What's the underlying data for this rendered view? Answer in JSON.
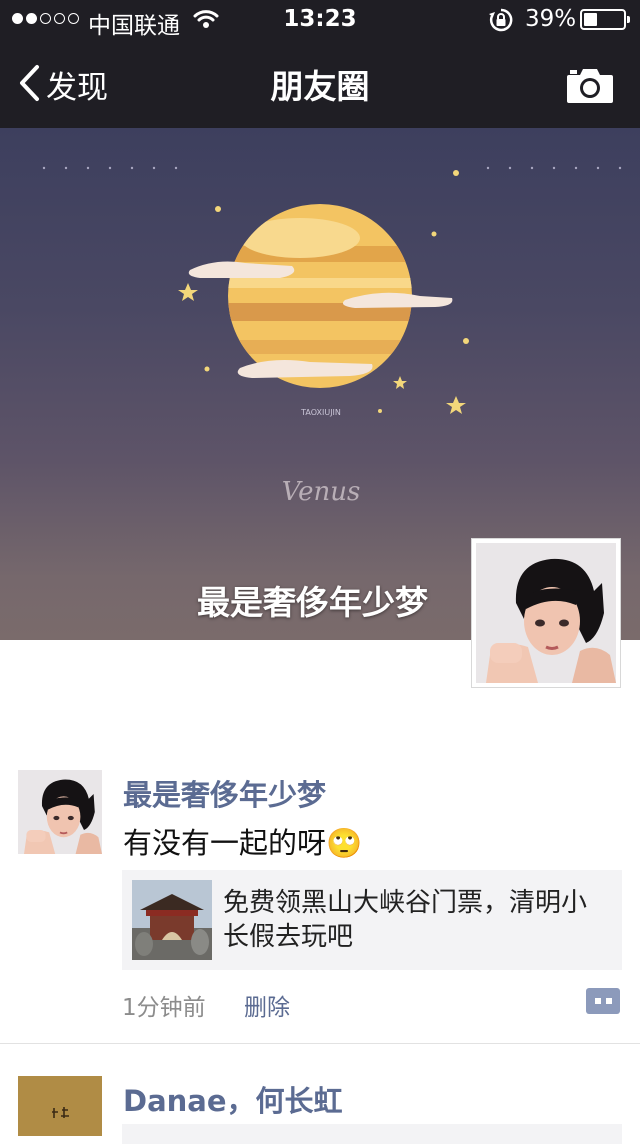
{
  "status_bar": {
    "carrier": "中国联通",
    "time": "13:23",
    "battery_percent": "39%",
    "battery_level": 0.39,
    "signal_bars_filled": 2,
    "signal_bars_total": 5,
    "icons": [
      "signal-dots-icon",
      "wifi-icon",
      "rotation-lock-icon",
      "battery-icon"
    ]
  },
  "nav": {
    "back_label": "发现",
    "title": "朋友圈",
    "icons": [
      "chevron-left-icon",
      "camera-icon"
    ]
  },
  "cover": {
    "caption": "Venus",
    "small_text": "TAOXIUJIN",
    "user_name": "最是奢侈年少梦"
  },
  "posts": [
    {
      "author": "最是奢侈年少梦",
      "text": "有没有一起的呀",
      "emoji": "🙄",
      "link_title": "免费领黑山大峡谷门票，清明小长假去玩吧",
      "time": "1分钟前",
      "delete_label": "删除"
    },
    {
      "author": "Danae，何长虹"
    }
  ],
  "colors": {
    "nav_bg": "#1f1e24",
    "name_link": "#5b6b92",
    "link_card_bg": "#f3f3f5",
    "comment_button": "#8c9abb"
  }
}
